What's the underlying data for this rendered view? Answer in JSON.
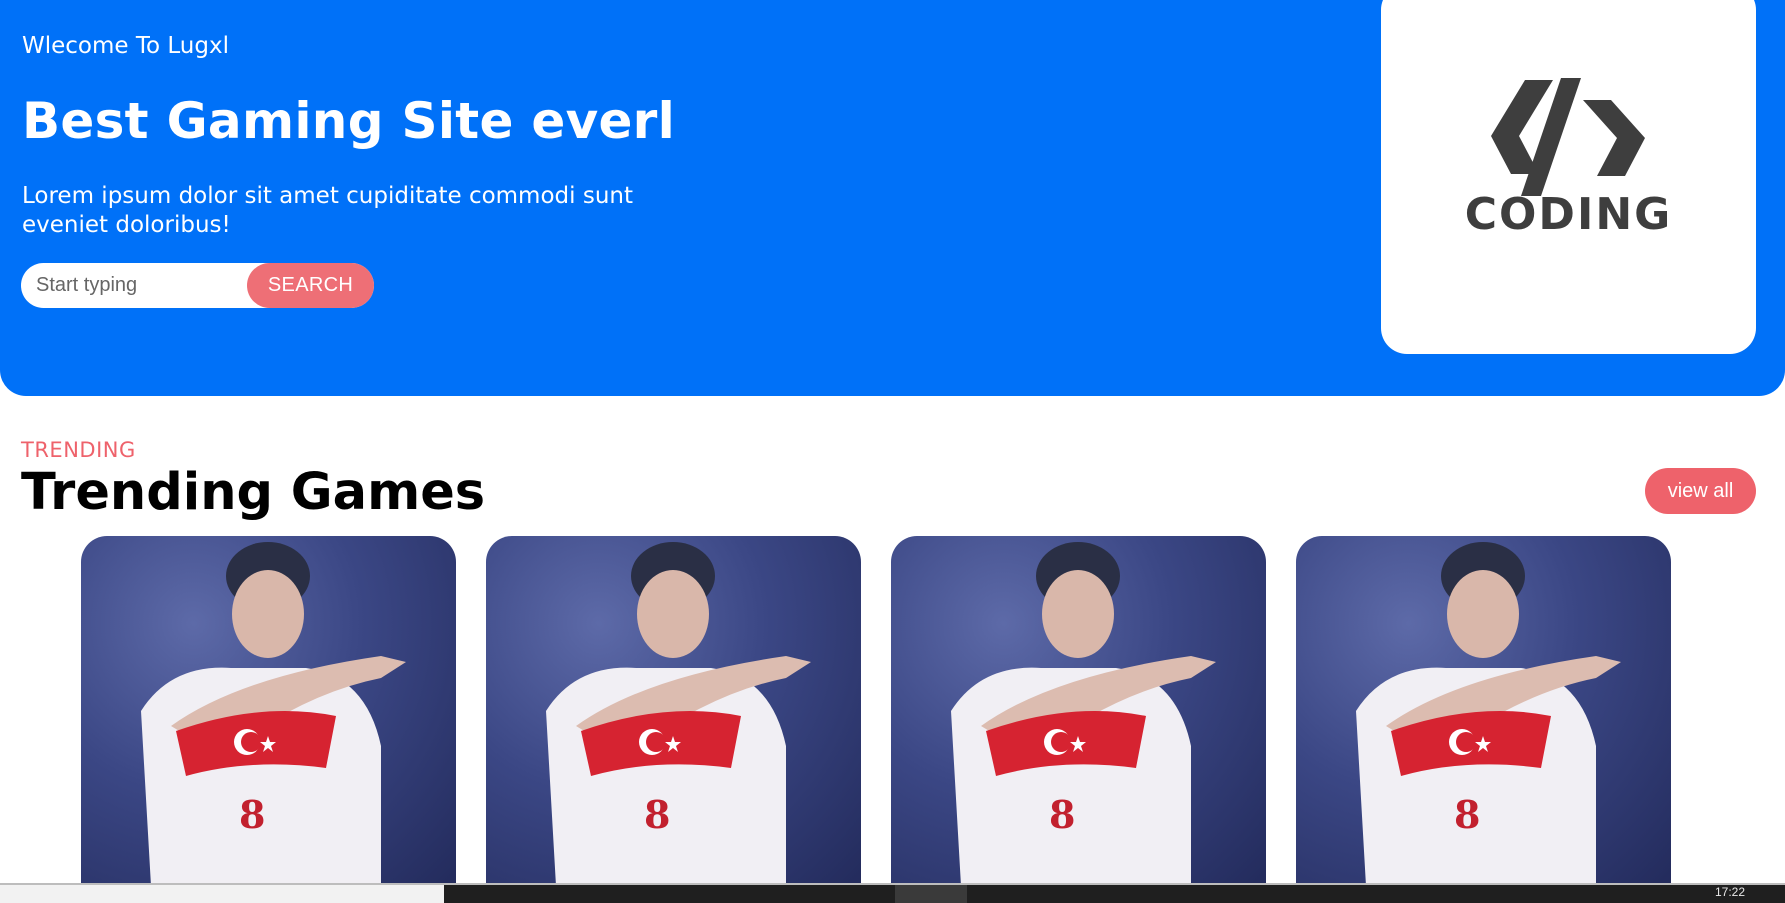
{
  "hero": {
    "welcome": "Wlecome To Lugxl",
    "title": "Best Gaming Site everl",
    "description": "Lorem ipsum dolor sit amet cupiditate commodi sunt eveniet doloribus!",
    "search_placeholder": "Start typing",
    "search_button": "SEARCH",
    "logo_text": "CODING"
  },
  "trending": {
    "eyebrow": "TRENDING",
    "title": "Trending Games",
    "view_all": "view all",
    "cards": [
      {
        "jersey_number": "8"
      },
      {
        "jersey_number": "8"
      },
      {
        "jersey_number": "8"
      },
      {
        "jersey_number": "8"
      }
    ]
  },
  "taskbar": {
    "clock": "17:22"
  },
  "colors": {
    "hero_blue": "#0071f8",
    "accent_red": "#ee626b",
    "search_button": "#ee6f76",
    "logo_gray": "#3e3e3e"
  }
}
